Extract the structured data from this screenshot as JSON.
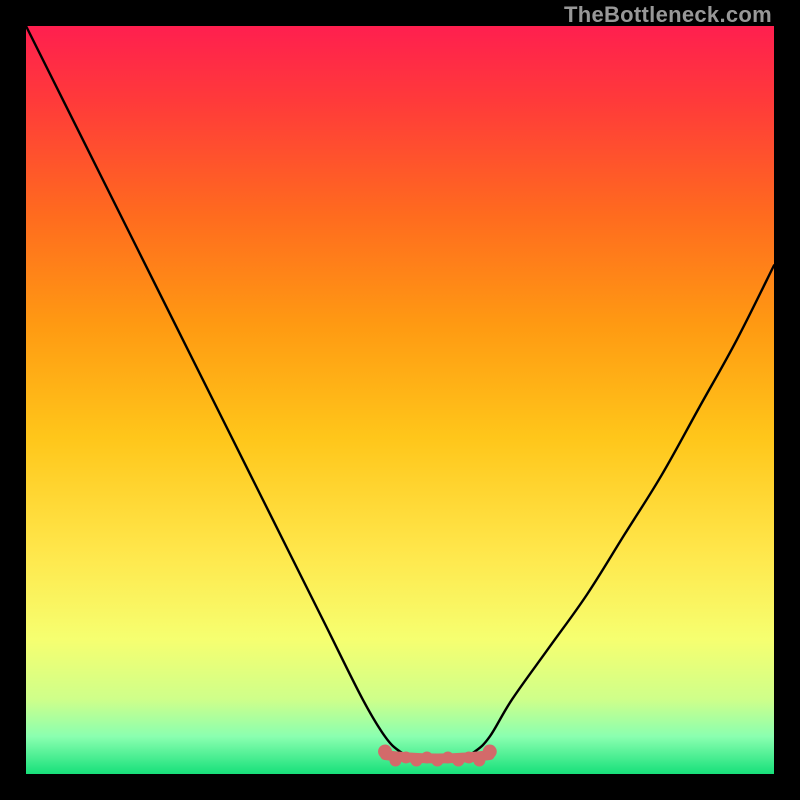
{
  "watermark": "TheBottleneck.com",
  "chart_data": {
    "type": "line",
    "title": "",
    "xlabel": "",
    "ylabel": "",
    "xlim": [
      0,
      100
    ],
    "ylim": [
      0,
      100
    ],
    "series": [
      {
        "name": "bottleneck-curve",
        "x": [
          0,
          5,
          10,
          15,
          20,
          25,
          30,
          35,
          40,
          45,
          48,
          50,
          52,
          54,
          56,
          58,
          60,
          62,
          65,
          70,
          75,
          80,
          85,
          90,
          95,
          100
        ],
        "y": [
          100,
          90,
          80,
          70,
          60,
          50,
          40,
          30,
          20,
          10,
          5,
          3,
          2,
          2,
          2,
          2,
          3,
          5,
          10,
          17,
          24,
          32,
          40,
          49,
          58,
          68
        ]
      }
    ],
    "flat_region": {
      "x_start": 48,
      "x_end": 62,
      "y": 2
    },
    "gradient_stops": [
      {
        "offset": 0.0,
        "color": "#ff1f4f"
      },
      {
        "offset": 0.1,
        "color": "#ff3a3a"
      },
      {
        "offset": 0.25,
        "color": "#ff6a1f"
      },
      {
        "offset": 0.4,
        "color": "#ff9a12"
      },
      {
        "offset": 0.55,
        "color": "#ffc61a"
      },
      {
        "offset": 0.7,
        "color": "#ffe64a"
      },
      {
        "offset": 0.82,
        "color": "#f6ff70"
      },
      {
        "offset": 0.9,
        "color": "#cfff8a"
      },
      {
        "offset": 0.95,
        "color": "#8affb0"
      },
      {
        "offset": 1.0,
        "color": "#17e07a"
      }
    ],
    "accent_color": "#d36a6a"
  }
}
